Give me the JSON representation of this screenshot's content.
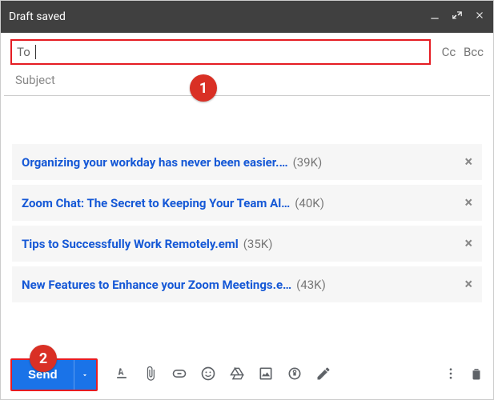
{
  "header": {
    "title": "Draft saved"
  },
  "recipients": {
    "to_label": "To",
    "to_value": "",
    "cc_label": "Cc",
    "bcc_label": "Bcc"
  },
  "subject": {
    "placeholder": "Subject",
    "value": ""
  },
  "attachments": [
    {
      "name": "Organizing your workday has never been easier.…",
      "size": "(39K)"
    },
    {
      "name": "Zoom Chat: The Secret to Keeping Your Team Al…",
      "size": "(40K)"
    },
    {
      "name": "Tips to Successfully Work Remotely.eml",
      "size": "(35K)"
    },
    {
      "name": "New Features to Enhance your Zoom Meetings.e…",
      "size": "(43K)"
    }
  ],
  "toolbar": {
    "send_label": "Send"
  },
  "callouts": {
    "one": "1",
    "two": "2"
  }
}
